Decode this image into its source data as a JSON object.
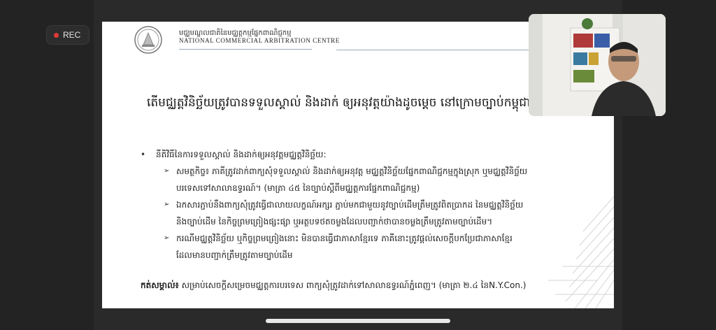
{
  "recording": {
    "label": "REC"
  },
  "slide": {
    "org_khmer": "មជ្ឈមណ្ឌលជាតិនៃមជ្ឈត្តកម្មផ្នែកពាណិជ្ជកម្ម",
    "org_english": "NATIONAL COMMERCIAL ARBITRATION CENTRE",
    "title": "តើមជ្ឈត្តវិនិច្ឆ័យត្រូវបានទទួលស្គាល់ និងដាក់ ឲ្យអនុវត្តយ៉ាងដូចម្តេច នៅក្រោមច្បាប់កម្ពុជា?",
    "bullet": "នីតិវិធីនៃការទទួលស្គាល់ និងដាក់ឲ្យអនុវត្តមជ្ឈត្តវិនិច្ឆ័យ:",
    "sub_items": [
      {
        "line1": "សមត្ថកិច្ច៖ ភាគីត្រូវដាក់ពាក្យសុំទទួលស្គាល់ និងដាក់ឲ្យអនុវត្ត មជ្ឈត្តវិនិច្ឆ័យផ្នែកពាណិជ្ជកម្មក្នុងស្រុក ឬមជ្ឈត្តវិនិច្ឆ័យ",
        "line2": "បរទេសទៅសាលាឧទ្ធរណ៍។ (មាត្រា ៤៥ នៃច្បាប់ស្តីពីមជ្ឈត្តការផ្នែកពាណិជ្ជកម្ម)"
      },
      {
        "line1": "ឯកសារភ្ជាប់នឹងពាក្យសុំត្រូវធ្វើជាលាយលក្ខណ៍អក្សរ ភ្ជាប់មកជាមួយនូវច្បាប់ដើមត្រឹមត្រូវពិតប្រាកដ នៃមជ្ឈត្តវិនិច្ឆ័យ",
        "line2": "និងច្បាប់ដើម នៃកិច្ចព្រមព្រៀងផ្សះផ្សា ឬអត្ថបទថតចម្លងដែលបញ្ជាក់ថាបានចម្លងត្រឹមត្រូវតាមច្បាប់ដើម។"
      },
      {
        "line1": "ករណីមជ្ឈត្តវិនិច្ឆ័យ ឬកិច្ចព្រមព្រៀងនោះ មិនបានធ្វើជាភាសាខ្មែរទេ ភាគីនោះត្រូវផ្តល់សេចក្តីបកប្រែជាភាសាខ្មែរ",
        "line2": "ដែលមានបញ្ជាក់ត្រឹមត្រូវតាមច្បាប់ដើម"
      }
    ],
    "note_label": "កត់សម្គាល់៖",
    "note_text": " សម្រាប់សេចក្តីសម្រេចមជ្ឈត្តការបរទេស ពាក្យសុំត្រូវដាក់ទៅសាលាឧទ្ធរណ៍ភ្នំពេញ។ (មាត្រា ២.៤ នៃN.Y.Con.)"
  },
  "colors": {
    "rec_dot": "#e53935",
    "slide_bg": "#ffffff",
    "app_bg": "#1f1f1f"
  }
}
